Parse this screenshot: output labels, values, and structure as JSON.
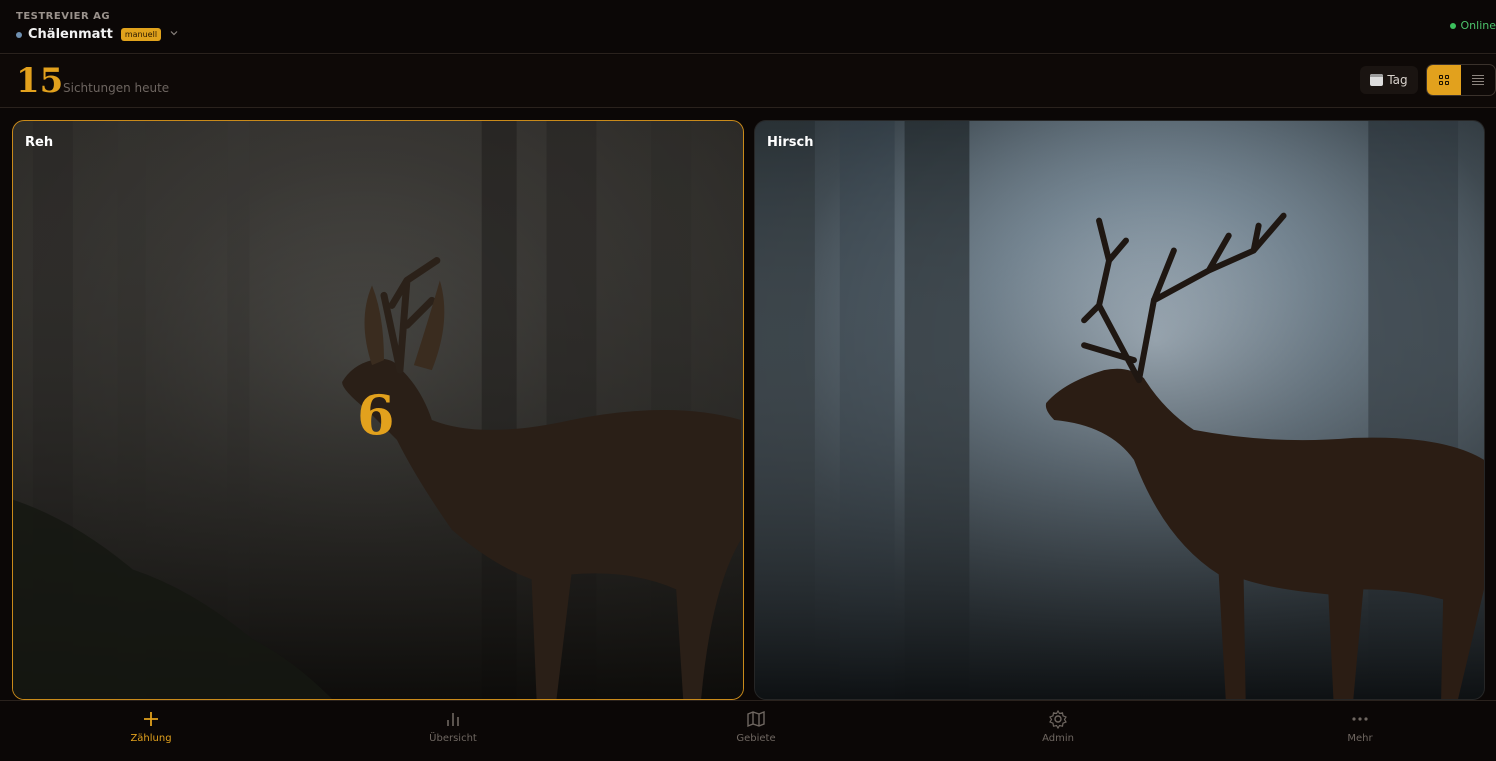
{
  "header": {
    "org": "TESTREVIER AG",
    "area_name": "Chälenmatt",
    "mode_badge": "manuell",
    "status": "Online",
    "status_color": "#4cc26a"
  },
  "summary": {
    "count": "15",
    "count_label": "Sichtungen heute",
    "period_button": "Tag",
    "view_modes": [
      "grid",
      "list"
    ],
    "active_view": "grid",
    "accent_color": "#e2a11d"
  },
  "cards": [
    {
      "label": "Reh",
      "count": "6",
      "selected": true
    },
    {
      "label": "Hirsch",
      "count": "",
      "selected": false
    }
  ],
  "nav": {
    "items": [
      {
        "label": "Zählung",
        "icon": "plus-icon",
        "active": true
      },
      {
        "label": "Übersicht",
        "icon": "bar-chart-icon",
        "active": false
      },
      {
        "label": "Gebiete",
        "icon": "map-icon",
        "active": false
      },
      {
        "label": "Admin",
        "icon": "gear-icon",
        "active": false
      },
      {
        "label": "Mehr",
        "icon": "more-dots-icon",
        "active": false
      }
    ]
  }
}
